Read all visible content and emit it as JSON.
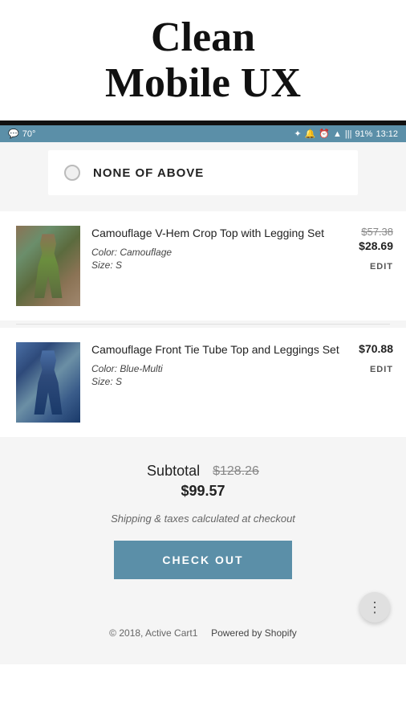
{
  "header": {
    "title": "Clean\nMobile UX"
  },
  "statusBar": {
    "leftIcon": "💬",
    "temp": "70°",
    "battery": "91%",
    "time": "13:12",
    "signalBars": "|||",
    "wifiIcon": "▲",
    "btIcon": "⚡"
  },
  "noneOption": {
    "label": "NONE OF ABOVE"
  },
  "products": [
    {
      "name": "Camouflage V-Hem Crop Top with Legging Set",
      "color": "Color: Camouflage",
      "size": "Size: S",
      "priceOriginal": "$57.38",
      "priceSale": "$28.69",
      "editLabel": "EDIT",
      "imgType": "camo1"
    },
    {
      "name": "Camouflage Front Tie Tube Top and Leggings Set",
      "color": "Color: Blue-Multi",
      "size": "Size: S",
      "priceOriginal": null,
      "priceSale": "$70.88",
      "editLabel": "EDIT",
      "imgType": "camo2"
    }
  ],
  "summary": {
    "subtotalLabel": "Subtotal",
    "subtotalOriginal": "$128.26",
    "subtotalFinal": "$99.57",
    "shippingNote": "Shipping & taxes calculated at checkout",
    "checkoutLabel": "CHECK OUT"
  },
  "footer": {
    "copyright": "© 2018, Active Cart1",
    "poweredBy": "Powered by Shopify"
  },
  "fab": {
    "icon": "⋮"
  }
}
